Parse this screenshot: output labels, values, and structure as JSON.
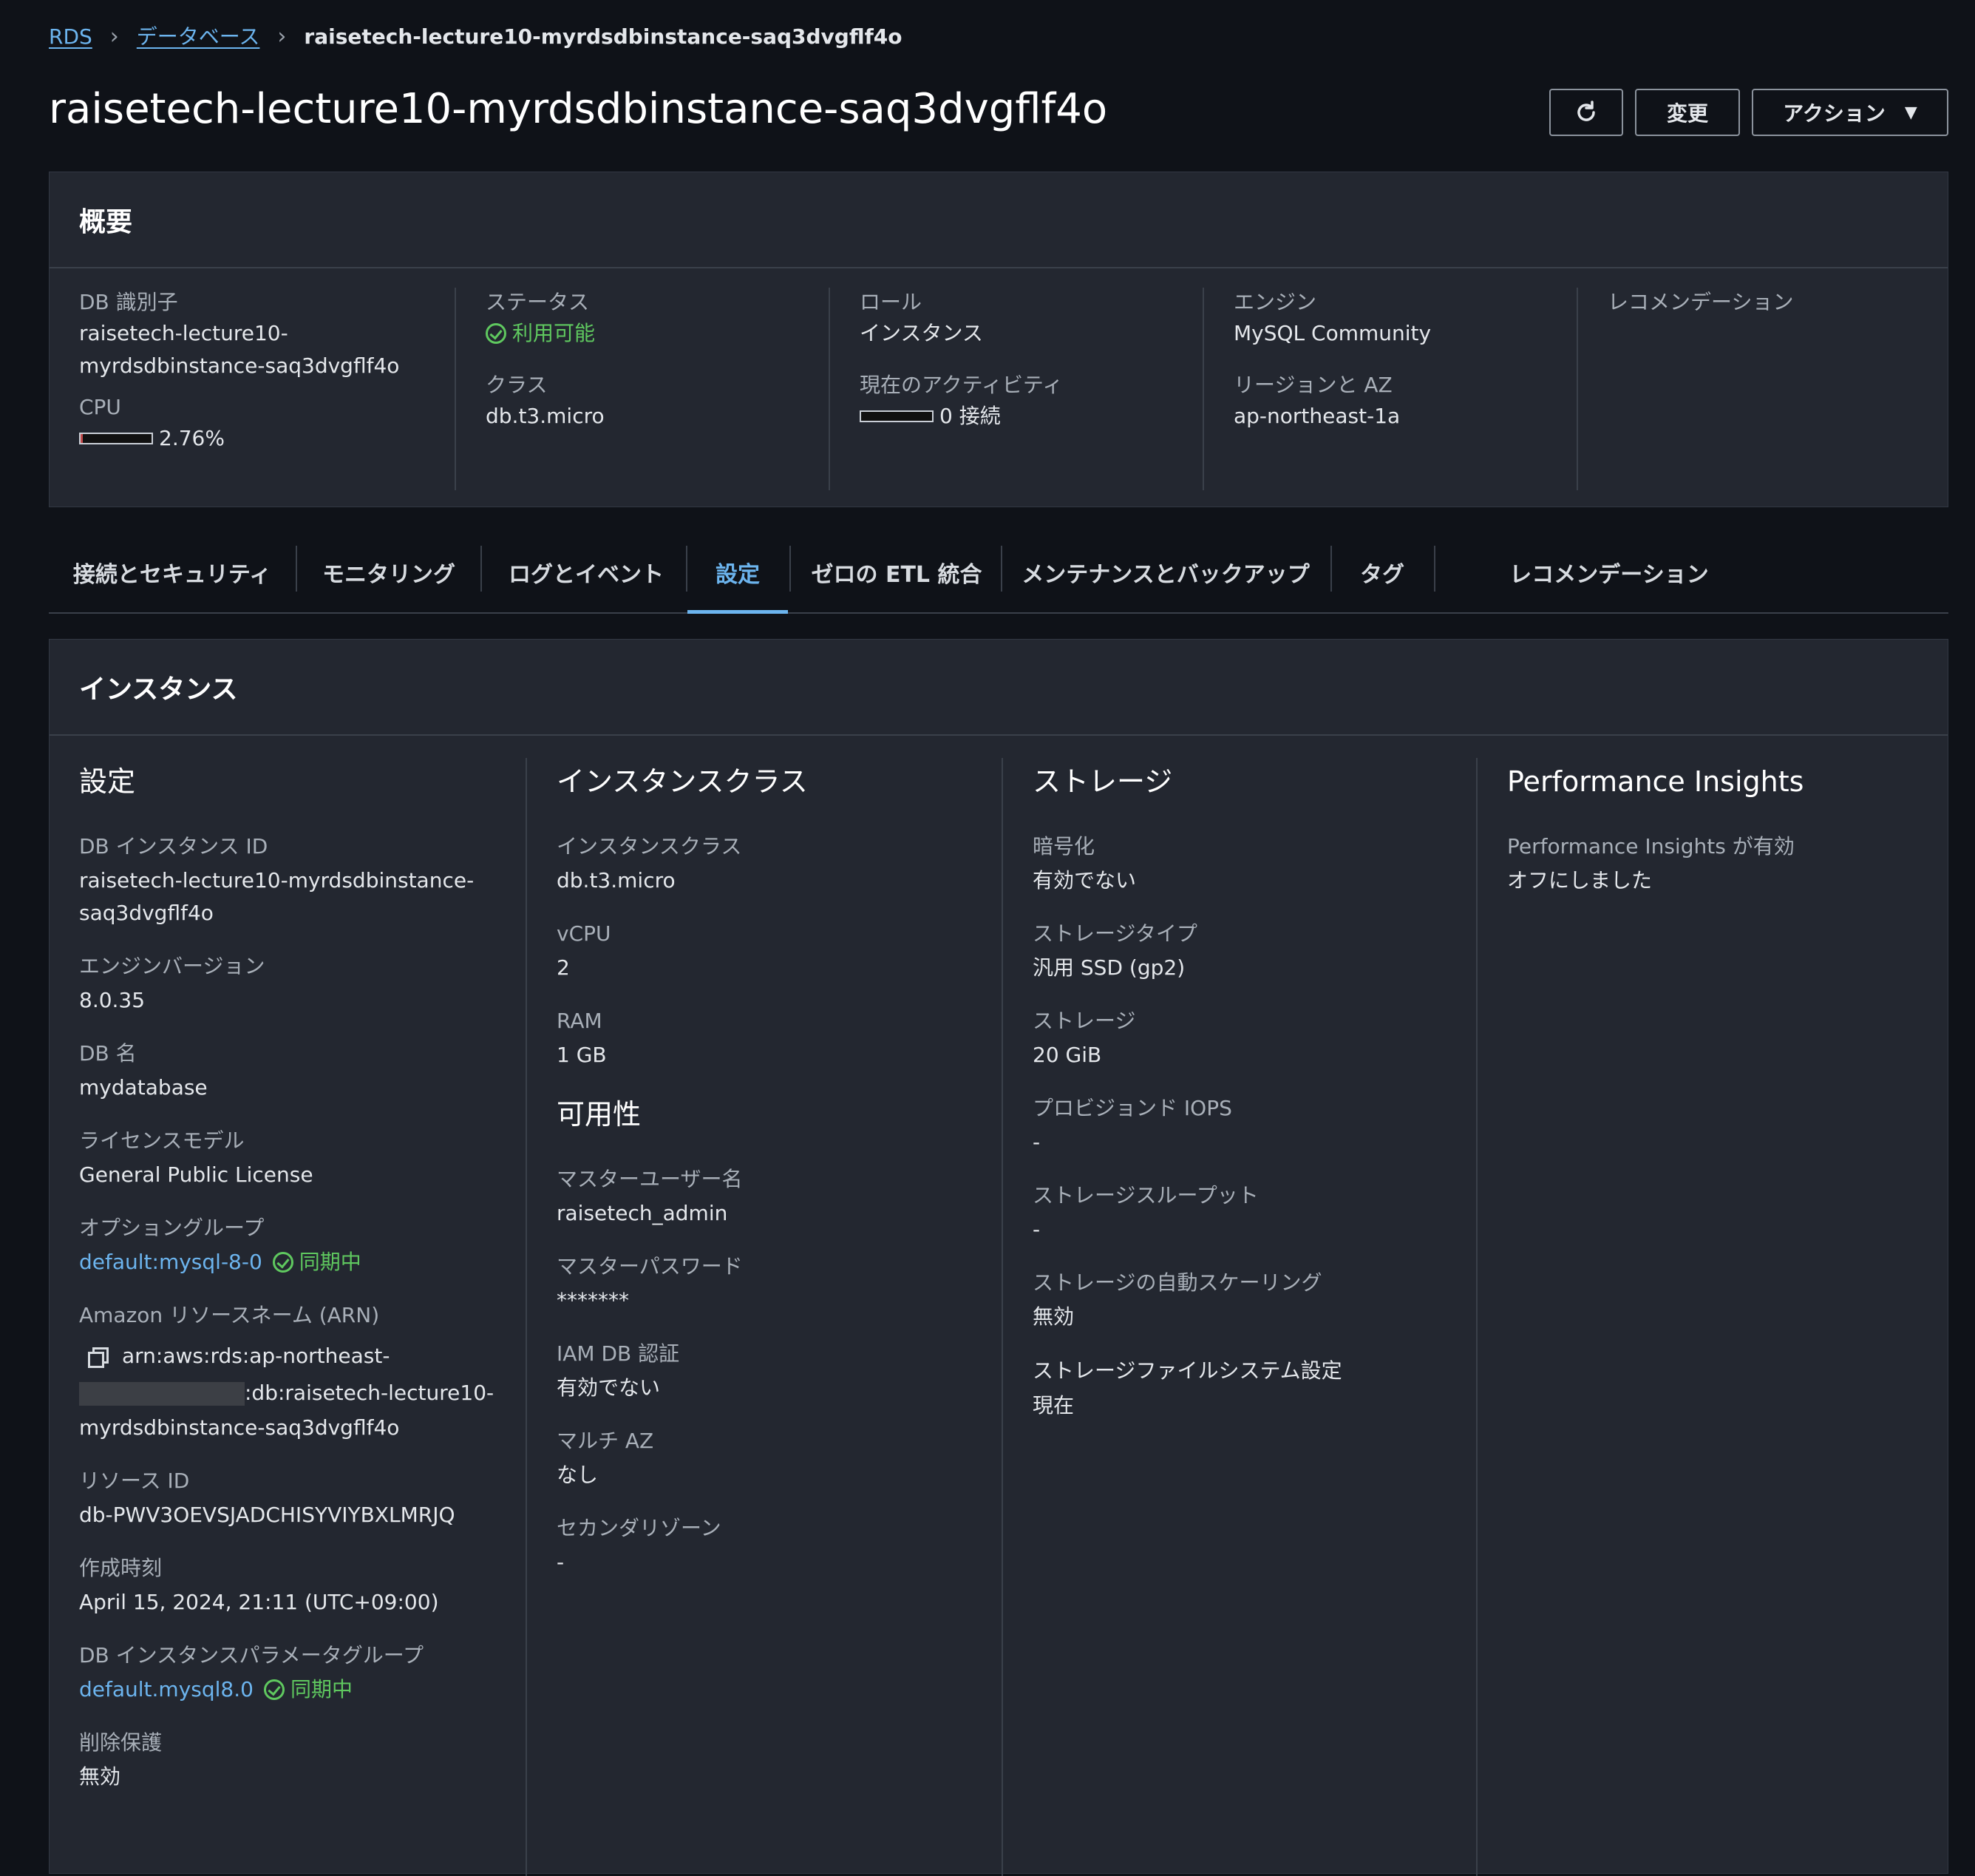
{
  "breadcrumb": {
    "items": [
      "RDS",
      "データベース"
    ],
    "current": "raisetech-lecture10-myrdsdbinstance-saq3dvgflf4o"
  },
  "page_title": "raisetech-lecture10-myrdsdbinstance-saq3dvgflf4o",
  "header_actions": {
    "refresh_icon": "refresh-icon",
    "modify_label": "変更",
    "actions_label": "アクション"
  },
  "summary": {
    "heading": "概要",
    "db_id_label": "DB 識別子",
    "db_id_value_1": "raisetech-lecture10-",
    "db_id_value_2": "myrdsdbinstance-saq3dvgflf4o",
    "cpu_label": "CPU",
    "cpu_value": "2.76%",
    "cpu_fraction": 0.0276,
    "status_label": "ステータス",
    "status_value": "利用可能",
    "class_label": "クラス",
    "class_value": "db.t3.micro",
    "role_label": "ロール",
    "role_value": "インスタンス",
    "activity_label": "現在のアクティビティ",
    "activity_value": "0 接続",
    "engine_label": "エンジン",
    "engine_value": "MySQL Community",
    "region_label": "リージョンと AZ",
    "region_value": "ap-northeast-1a",
    "recommend_label": "レコメンデーション"
  },
  "tabs": [
    {
      "label": "接続とセキュリティ"
    },
    {
      "label": "モニタリング"
    },
    {
      "label": "ログとイベント"
    },
    {
      "label": "設定"
    },
    {
      "label": "ゼロの ETL 統合"
    },
    {
      "label": "メンテナンスとバックアップ"
    },
    {
      "label": "タグ"
    },
    {
      "label": "レコメンデーション"
    }
  ],
  "active_tab": "設定",
  "colors": {
    "accent": "#6cb4ee",
    "success": "#5fc85f",
    "background": "#0f1218",
    "panel": "#232730"
  },
  "instance": {
    "heading": "インスタンス",
    "config": {
      "title": "設定",
      "db_instance_id_label": "DB インスタンス ID",
      "db_instance_id_1": "raisetech-lecture10-myrdsdbinstance-",
      "db_instance_id_2": "saq3dvgflf4o",
      "engine_version_label": "エンジンバージョン",
      "engine_version": "8.0.35",
      "db_name_label": "DB 名",
      "db_name": "mydatabase",
      "license_label": "ライセンスモデル",
      "license": "General Public License",
      "option_group_label": "オプショングループ",
      "option_group": "default:mysql-8-0",
      "option_group_status": "同期中",
      "arn_label": "Amazon リソースネーム (ARN)",
      "arn_1": "arn:aws:rds:ap-northeast-",
      "arn_2": ":db:raisetech-lecture10-",
      "arn_3": "myrdsdbinstance-saq3dvgflf4o",
      "resource_id_label": "リソース ID",
      "resource_id": "db-PWV3OEVSJADCHISYVIYBXLMRJQ",
      "created_label": "作成時刻",
      "created": "April 15, 2024, 21:11 (UTC+09:00)",
      "param_group_label": "DB インスタンスパラメータグループ",
      "param_group": "default.mysql8.0",
      "param_group_status": "同期中",
      "deletion_label": "削除保護",
      "deletion": "無効"
    },
    "class": {
      "title": "インスタンスクラス",
      "class_label": "インスタンスクラス",
      "class_value": "db.t3.micro",
      "vcpu_label": "vCPU",
      "vcpu_value": "2",
      "ram_label": "RAM",
      "ram_value": "1 GB",
      "avail_title": "可用性",
      "master_user_label": "マスターユーザー名",
      "master_user": "raisetech_admin",
      "master_pw_label": "マスターパスワード",
      "master_pw": "*******",
      "iam_label": "IAM DB 認証",
      "iam": "有効でない",
      "multi_az_label": "マルチ AZ",
      "multi_az": "なし",
      "secondary_zone_label": "セカンダリゾーン",
      "secondary_zone": "-"
    },
    "storage": {
      "title": "ストレージ",
      "encryption_label": "暗号化",
      "encryption": "有効でない",
      "type_label": "ストレージタイプ",
      "type": "汎用 SSD (gp2)",
      "size_label": "ストレージ",
      "size": "20 GiB",
      "iops_label": "プロビジョンド IOPS",
      "iops": "-",
      "throughput_label": "ストレージスループット",
      "throughput": "-",
      "autoscale_label": "ストレージの自動スケーリング",
      "autoscale": "無効",
      "fs_label": "ストレージファイルシステム設定",
      "fs": "現在"
    },
    "pi": {
      "title": "Performance Insights",
      "enabled_label": "Performance Insights が有効",
      "enabled": "オフにしました"
    }
  }
}
